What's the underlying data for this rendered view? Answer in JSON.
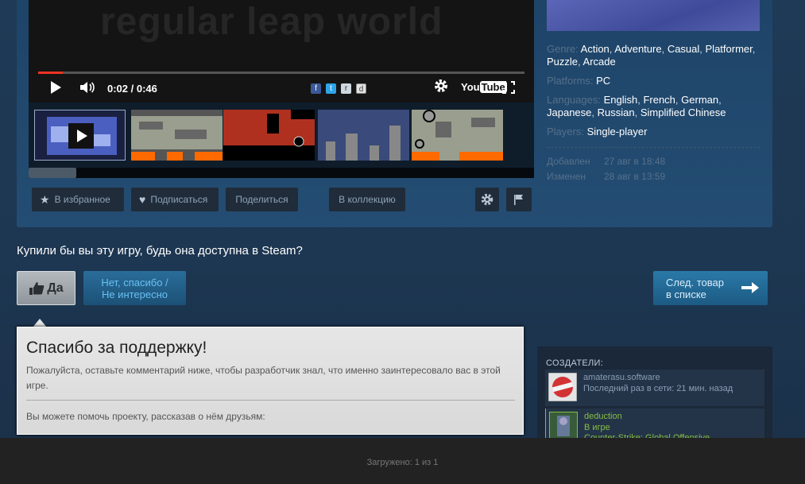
{
  "video": {
    "bg_text": "regular leap world",
    "time": "0:02 / 0:46",
    "progress": 0.05,
    "youtube_you": "You",
    "youtube_tube": "Tube"
  },
  "actions": {
    "wishlist": "В избранное",
    "follow": "Подписаться",
    "share": "Поделиться",
    "collection": "В коллекцию"
  },
  "details": {
    "genre_label": "Genre:",
    "genres": [
      "Action",
      "Adventure",
      "Casual",
      "Platformer",
      "Puzzle",
      "Arcade"
    ],
    "platforms_label": "Platforms:",
    "platforms": "PC",
    "languages_label": "Languages:",
    "languages": [
      "English",
      "French",
      "German",
      "Japanese",
      "Russian",
      "Simplified Chinese"
    ],
    "players_label": "Players:",
    "players": "Single-player",
    "added_label": "Добавлен",
    "added_value": "27 авг в 18:48",
    "changed_label": "Изменен",
    "changed_value": "28 авг в 13:59"
  },
  "vote": {
    "question": "Купили бы вы эту игру, будь она доступна в Steam?",
    "yes": "Да",
    "no_line1": "Нет, спасибо /",
    "no_line2": "Не интересно",
    "next_line1": "След. товар",
    "next_line2": "в списке"
  },
  "thanks": {
    "title": "Спасибо за поддержку!",
    "body": "Пожалуйста, оставьте комментарий ниже, чтобы разработчик знал, что именно заинтересовало вас в этой игре.",
    "share": "Вы можете помочь проекту, рассказав о нём друзьям:"
  },
  "creators": {
    "header": "СОЗДАТЕЛИ:",
    "items": [
      {
        "name": "amaterasu.software",
        "status": "Последний раз в сети: 21 мин. назад",
        "status2": ""
      },
      {
        "name": "deduction",
        "status": "В игре",
        "status2": "Counter-Strike: Global Offensive"
      }
    ]
  },
  "footer": {
    "loaded": "Загружено: 1 из 1"
  }
}
